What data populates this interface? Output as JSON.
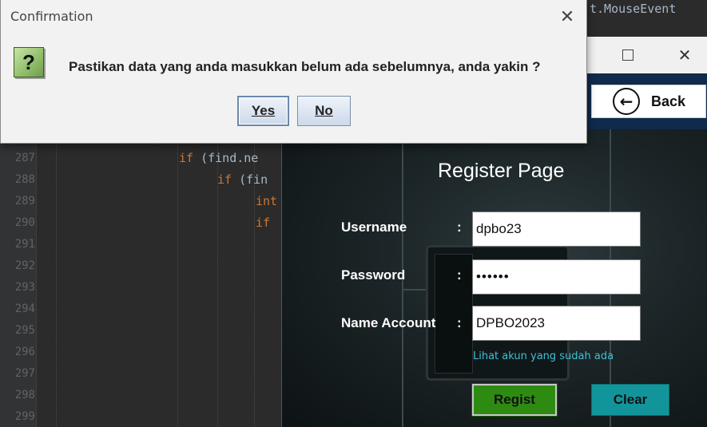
{
  "ide": {
    "title_fragment": "t.MouseEvent",
    "line_numbers": [
      "287",
      "288",
      "289",
      "290",
      "291",
      "292",
      "293",
      "294",
      "295",
      "296",
      "297",
      "298",
      "299"
    ],
    "code_lines": [
      {
        "kw": "if",
        "rest": " (find.ne"
      },
      {
        "kw": "if",
        "rest": " (fin"
      },
      {
        "kw": "int",
        "rest": ""
      },
      {
        "kw": "if",
        "rest": ""
      }
    ],
    "brace_fragment": "} ("
  },
  "register_window": {
    "maximize_icon": "maximize-icon",
    "close_symbol": "✕",
    "back_button": {
      "label": "Back",
      "icon": "arrow-left-circle-icon",
      "arrow": "←"
    },
    "page_title": "Register Page",
    "fields": {
      "username": {
        "label": "Username",
        "colon": ":",
        "value": "dpbo23"
      },
      "password": {
        "label": "Password",
        "colon": ":",
        "value": "••••••"
      },
      "name_account": {
        "label": "Name Account",
        "colon": ":",
        "value": "DPBO2023"
      }
    },
    "link_existing": "Lihat akun yang sudah ada",
    "regist_button": "Regist",
    "clear_button": "Clear",
    "colors": {
      "navbar": "#0f2a4c",
      "regist": "#2e8b12",
      "clear": "#11959b",
      "link": "#3fc0d6"
    }
  },
  "dialog": {
    "title": "Confirmation",
    "close_symbol": "✕",
    "icon": "question-icon",
    "icon_glyph": "?",
    "message": "Pastikan data yang anda masukkan belum ada sebelumnya, anda yakin ?",
    "yes_label": "Yes",
    "no_label": "No"
  }
}
